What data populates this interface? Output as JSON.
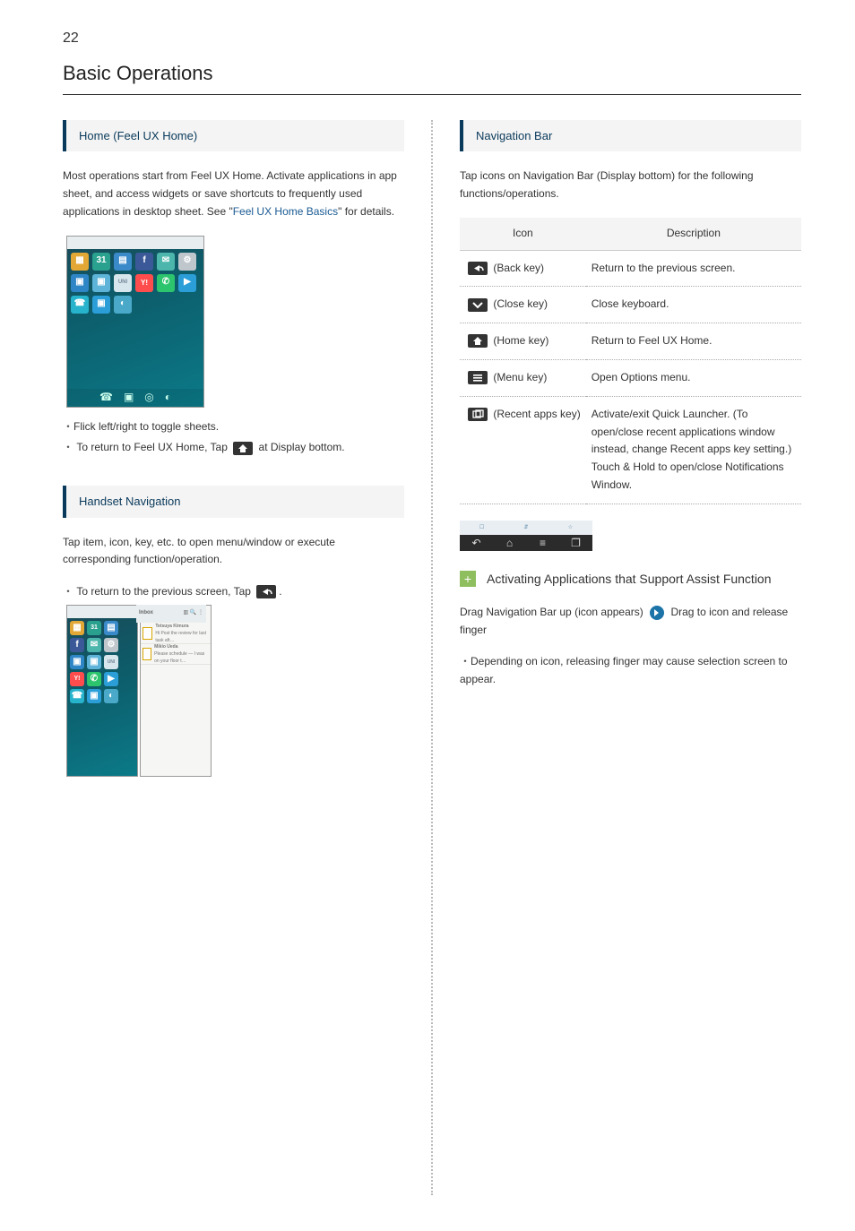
{
  "page_number": "22",
  "title": "Basic Operations",
  "left": {
    "s1_head": "Home (Feel UX Home)",
    "s1_p_a": "Most operations start from Feel UX Home.  Activate applications in app sheet, and access widgets or save shortcuts to frequently used applications in desktop sheet. See \"",
    "s1_link": "Feel UX Home Basics",
    "s1_p_b": "\" for details.",
    "b1": "Flick left/right to toggle sheets.",
    "b2a": "To return to Feel UX Home, Tap ",
    "b2b": " at Display bottom.",
    "s2_head": "Handset Navigation",
    "s2_p": "Tap item, icon, key, etc. to open menu/window or execute corresponding function/operation.",
    "b3a": "To return to the previous screen, Tap ",
    "b3b": "."
  },
  "right": {
    "s3_head": "Navigation Bar",
    "s3_p": "Tap icons on Navigation Bar (Display bottom) for the following functions/operations.",
    "table": {
      "h1": "Icon",
      "h2": "Description",
      "r1": {
        "label": " (Back key)",
        "desc": "Return to the previous screen."
      },
      "r2": {
        "label": " (Close key)",
        "desc": "Close keyboard."
      },
      "r3": {
        "label": " (Home key)",
        "desc": "Return to Feel UX Home."
      },
      "r4": {
        "label": " (Menu key)",
        "desc": "Open Options menu."
      },
      "r5": {
        "label": " (Recent apps key)",
        "desc": "Activate/exit Quick Launcher. (To open/close recent applications window instead, change Recent apps key setting.)\nTouch & Hold to open/close Notifications Window."
      }
    },
    "s4_head": "Activating Applications that Support Assist Function",
    "s4_p1a": "Drag Navigation Bar up (icon appears) ",
    "s4_p1b": " Drag to icon and release finger",
    "s4_b1": "Depending on icon, releasing finger may cause selection screen to appear."
  }
}
